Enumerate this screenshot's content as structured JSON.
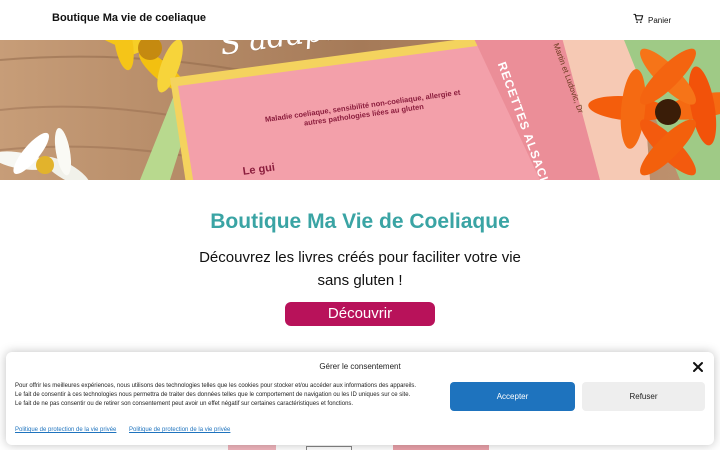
{
  "header": {
    "brand": "Boutique Ma vie de coeliaque",
    "cart_label": "Panier",
    "cart_icon": "shopping-cart-icon"
  },
  "hero": {
    "book_title": "S'adapter Sans Gluten",
    "book_subtitle": "Maladie coeliaque, sensibilité non-coeliaque, allergie et autres pathologies liées au gluten",
    "book_footer": "Le gui",
    "book2_title": "RECETTES ALSACIENNE",
    "book2_authors": "Martin et Ludovic, Dr"
  },
  "main": {
    "title": "Boutique Ma Vie de Coeliaque",
    "description": "Découvrez les livres créés pour faciliter votre vie sans gluten !",
    "cta_label": "Découvrir"
  },
  "consent": {
    "title": "Gérer le consentement",
    "text_1": "Pour offrir les meilleures expériences, nous utilisons des technologies telles que les cookies pour stocker et/ou accéder aux informations des appareils.",
    "text_2": "Le fait de consentir à ces technologies nous permettra de traiter des données telles que le comportement de navigation ou les ID uniques sur ce site.",
    "text_3": "Le fait de ne pas consentir ou de retirer son consentement peut avoir un effet négatif sur certaines caractéristiques et fonctions.",
    "accept_label": "Accepter",
    "refuse_label": "Refuser",
    "policy_link_1": "Politique de protection de la vie privée",
    "policy_link_2": "Politique de protection de la vie privée",
    "close_icon": "close-icon"
  },
  "colors": {
    "accent_teal": "#3aa4a4",
    "cta_magenta": "#b8125a",
    "accept_blue": "#1e73be"
  }
}
